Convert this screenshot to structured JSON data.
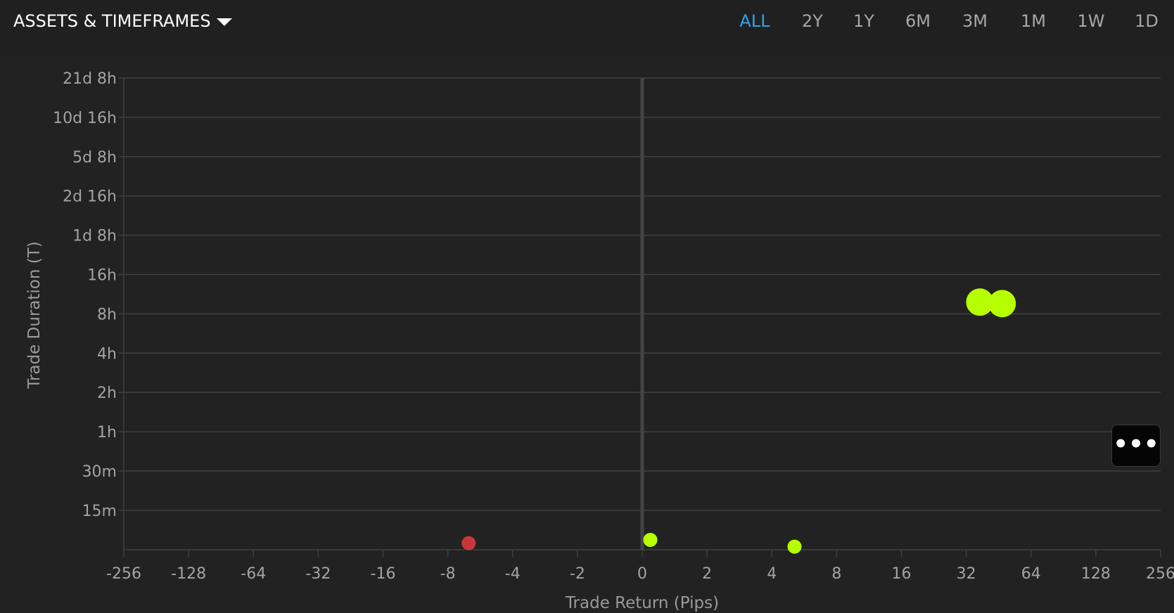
{
  "header": {
    "assets_label": "ASSETS & TIMEFRAMES",
    "timeframes": [
      "ALL",
      "2Y",
      "1Y",
      "6M",
      "3M",
      "1M",
      "1W",
      "1D"
    ],
    "active_timeframe": "ALL"
  },
  "more_button": {
    "label": "•••"
  },
  "colors": {
    "background": "#1c1c1c",
    "plot_background": "#222222",
    "gridline": "#404040",
    "zero_line": "#444444",
    "accent": "#2ea5ea",
    "win": "#b6ff00",
    "loss": "#c8383a"
  },
  "chart_data": {
    "type": "scatter",
    "xlabel": "Trade Return (Pips)",
    "ylabel": "Trade Duration (T)",
    "x_scale": "symmetric-log2",
    "x_ticks": [
      "-256",
      "-128",
      "-64",
      "-32",
      "-16",
      "-8",
      "-4",
      "-2",
      "0",
      "2",
      "4",
      "8",
      "16",
      "32",
      "64",
      "128",
      "256"
    ],
    "y_scale": "log2",
    "y_ticks": [
      "15m",
      "30m",
      "1h",
      "2h",
      "4h",
      "8h",
      "16h",
      "1d 8h",
      "2d 16h",
      "5d 8h",
      "10d 16h",
      "21d 8h"
    ],
    "grid": true,
    "legend": "none",
    "points": [
      {
        "x": -6.4,
        "y_minutes": 8.4,
        "size": "small",
        "outcome": "loss"
      },
      {
        "x": 0.25,
        "y_minutes": 8.9,
        "size": "small",
        "outcome": "win"
      },
      {
        "x": 5.1,
        "y_minutes": 7.9,
        "size": "small",
        "outcome": "win"
      },
      {
        "x": 37,
        "y_minutes": 590,
        "size": "large",
        "outcome": "win"
      },
      {
        "x": 47,
        "y_minutes": 575,
        "size": "large",
        "outcome": "win"
      }
    ]
  }
}
